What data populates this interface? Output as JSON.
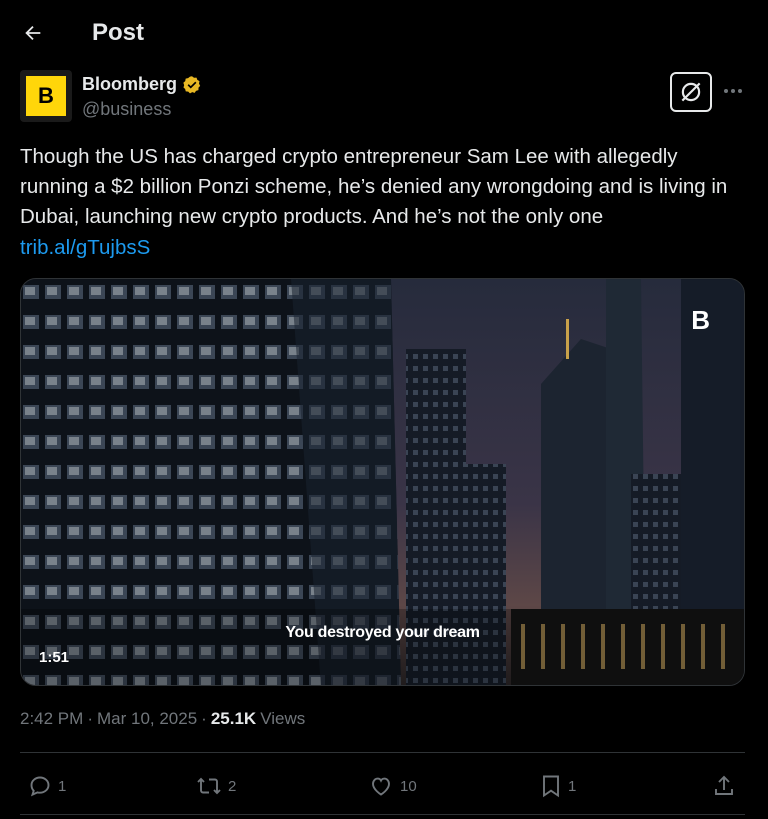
{
  "header": {
    "title": "Post",
    "back_icon": "arrow-left-icon"
  },
  "author": {
    "name": "Bloomberg",
    "handle": "@business",
    "avatar_letter": "B",
    "verified_icon": "gold-verified-badge-icon",
    "brand_color": "#ffd60a"
  },
  "post": {
    "text": "Though the US has charged crypto entrepreneur Sam Lee with allegedly running a $2 billion Ponzi scheme, he’s denied any wrongdoing and is living in Dubai, launching new crypto products. And he’s not the only one",
    "link": "trib.al/gTujbsS"
  },
  "media": {
    "caption": "You destroyed your dream",
    "duration": "1:51",
    "watermark": "B"
  },
  "meta": {
    "time": "2:42 PM",
    "date": "Mar 10, 2025",
    "views_count": "25.1K",
    "views_label": "Views"
  },
  "actions": {
    "replies": "1",
    "reposts": "2",
    "likes": "10",
    "bookmarks": "1"
  },
  "colors": {
    "background": "#000000",
    "text": "#e7e9ea",
    "muted": "#71767b",
    "link": "#1d9bf0",
    "border": "#2f3336"
  }
}
